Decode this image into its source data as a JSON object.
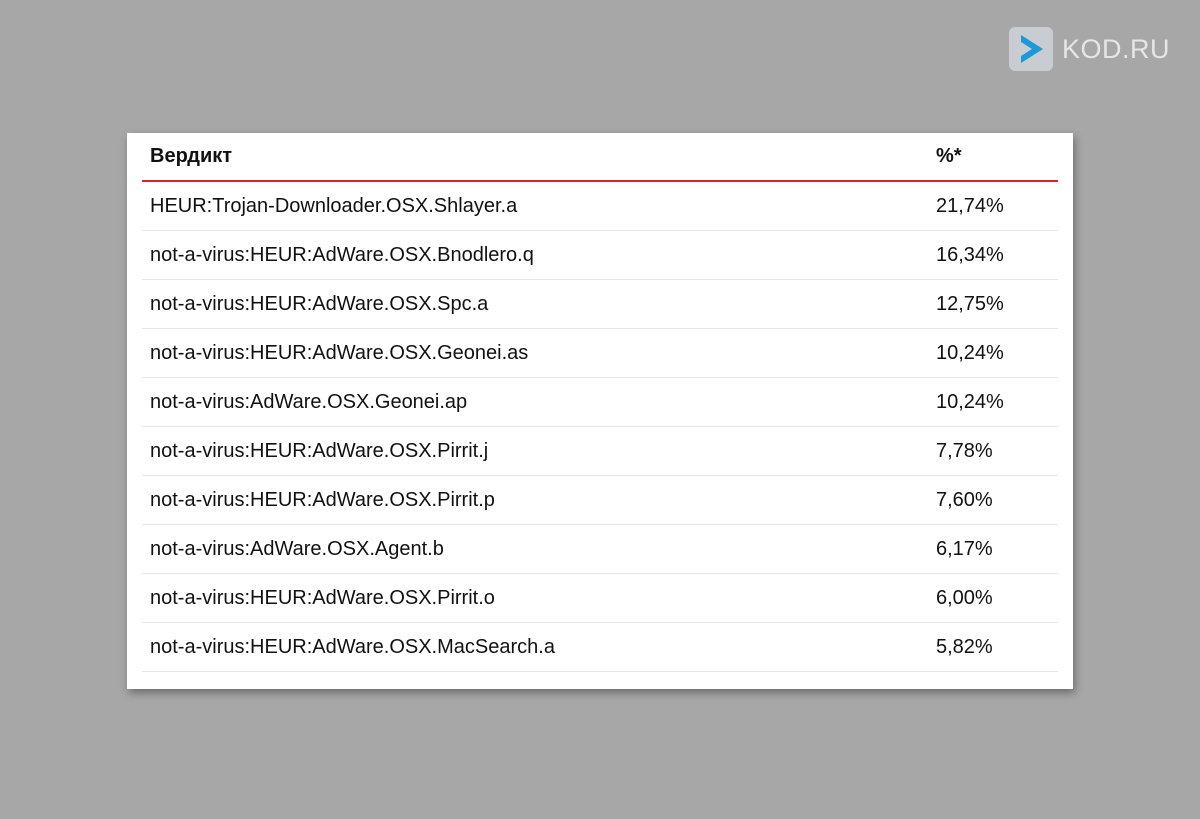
{
  "logo": {
    "text": "KOD.RU",
    "icon": "kod-play-arrow-icon"
  },
  "table": {
    "headers": {
      "verdict": "Вердикт",
      "percent": "%*"
    },
    "rows": [
      {
        "verdict": "HEUR:Trojan-Downloader.OSX.Shlayer.a",
        "percent": "21,74%"
      },
      {
        "verdict": "not-a-virus:HEUR:AdWare.OSX.Bnodlero.q",
        "percent": "16,34%"
      },
      {
        "verdict": "not-a-virus:HEUR:AdWare.OSX.Spc.a",
        "percent": "12,75%"
      },
      {
        "verdict": "not-a-virus:HEUR:AdWare.OSX.Geonei.as",
        "percent": "10,24%"
      },
      {
        "verdict": "not-a-virus:AdWare.OSX.Geonei.ap",
        "percent": "10,24%"
      },
      {
        "verdict": "not-a-virus:HEUR:AdWare.OSX.Pirrit.j",
        "percent": "7,78%"
      },
      {
        "verdict": "not-a-virus:HEUR:AdWare.OSX.Pirrit.p",
        "percent": "7,60%"
      },
      {
        "verdict": "not-a-virus:AdWare.OSX.Agent.b",
        "percent": "6,17%"
      },
      {
        "verdict": "not-a-virus:HEUR:AdWare.OSX.Pirrit.o",
        "percent": "6,00%"
      },
      {
        "verdict": "not-a-virus:HEUR:AdWare.OSX.MacSearch.a",
        "percent": "5,82%"
      }
    ]
  },
  "colors": {
    "background": "#a7a7a7",
    "header_rule": "#e31e24",
    "row_divider": "#dfe8ea",
    "logo_arrow": "#1a9ad6"
  }
}
